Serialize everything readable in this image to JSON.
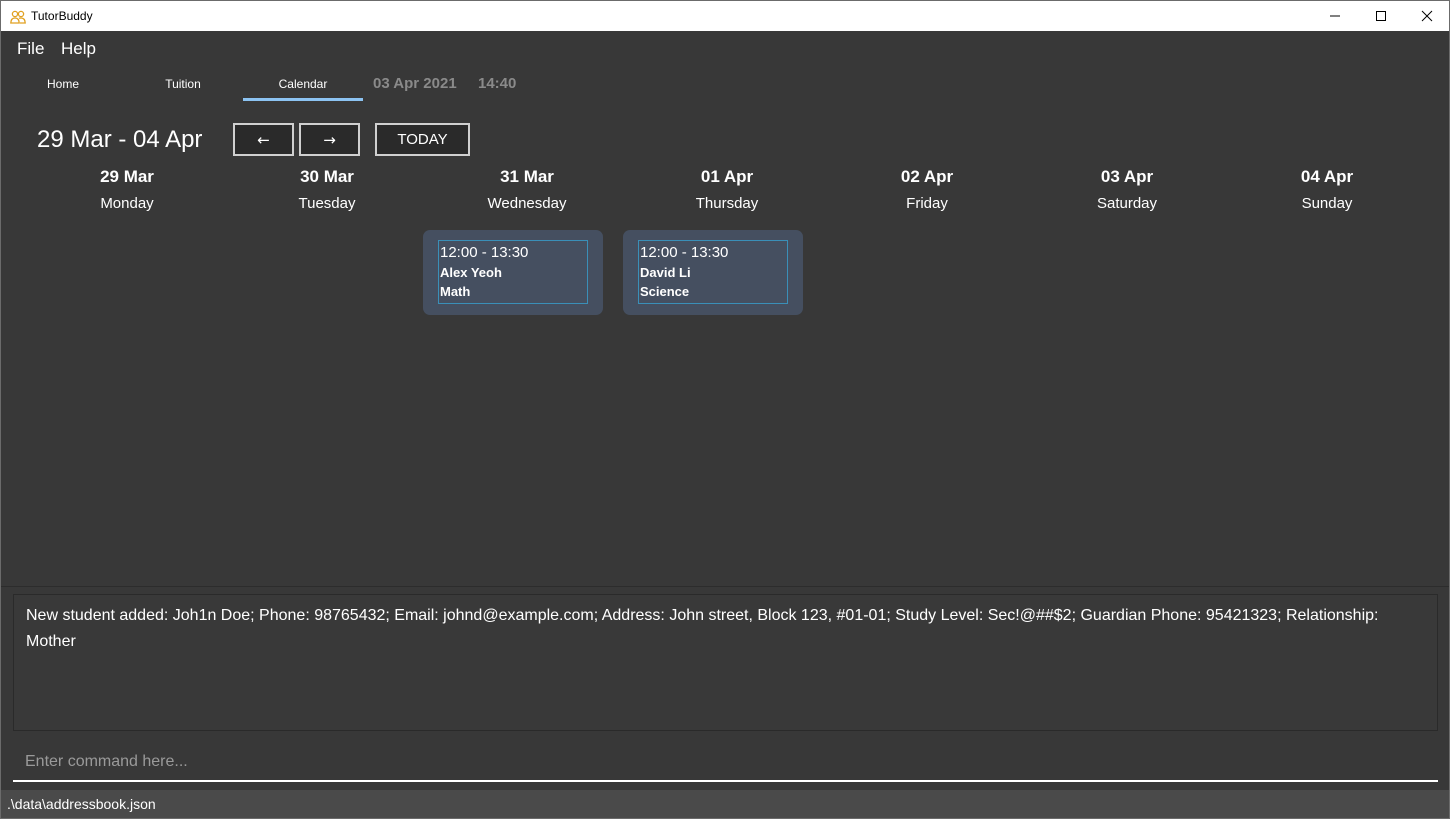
{
  "window": {
    "title": "TutorBuddy"
  },
  "menu": {
    "file": "File",
    "help": "Help"
  },
  "tabs": {
    "home": "Home",
    "tuition": "Tuition",
    "calendar": "Calendar",
    "active": "Calendar"
  },
  "clock": {
    "date": "03 Apr 2021",
    "time": "14:40"
  },
  "calendar": {
    "week_range": "29 Mar - 04 Apr",
    "prev_label": "←",
    "next_label": "→",
    "today_label": "TODAY",
    "days": [
      {
        "date": "29 Mar",
        "name": "Monday"
      },
      {
        "date": "30 Mar",
        "name": "Tuesday"
      },
      {
        "date": "31 Mar",
        "name": "Wednesday"
      },
      {
        "date": "01 Apr",
        "name": "Thursday"
      },
      {
        "date": "02 Apr",
        "name": "Friday"
      },
      {
        "date": "03 Apr",
        "name": "Saturday"
      },
      {
        "date": "04 Apr",
        "name": "Sunday"
      }
    ],
    "events": [
      {
        "day": "31 Mar",
        "time": "12:00 - 13:30",
        "student": "Alex Yeoh",
        "subject": "Math"
      },
      {
        "day": "01 Apr",
        "time": "12:00 - 13:30",
        "student": "David Li",
        "subject": "Science"
      }
    ]
  },
  "result": {
    "text": "New student added: Joh1n Doe; Phone: 98765432; Email: johnd@example.com; Address: John street, Block 123, #01-01; Study Level: Sec!@##$2; Guardian Phone: 95421323; Relationship: Mother"
  },
  "command": {
    "placeholder": "Enter command here...",
    "value": ""
  },
  "status": {
    "path": ".\\data\\addressbook.json"
  },
  "colors": {
    "background": "#383838",
    "accent": "#8cc3f2",
    "event_card": "#454f60",
    "event_border": "#3a8fb8"
  },
  "icons": {
    "app": "people-icon",
    "minimize": "minimize-icon",
    "maximize": "maximize-icon",
    "close": "close-icon"
  }
}
